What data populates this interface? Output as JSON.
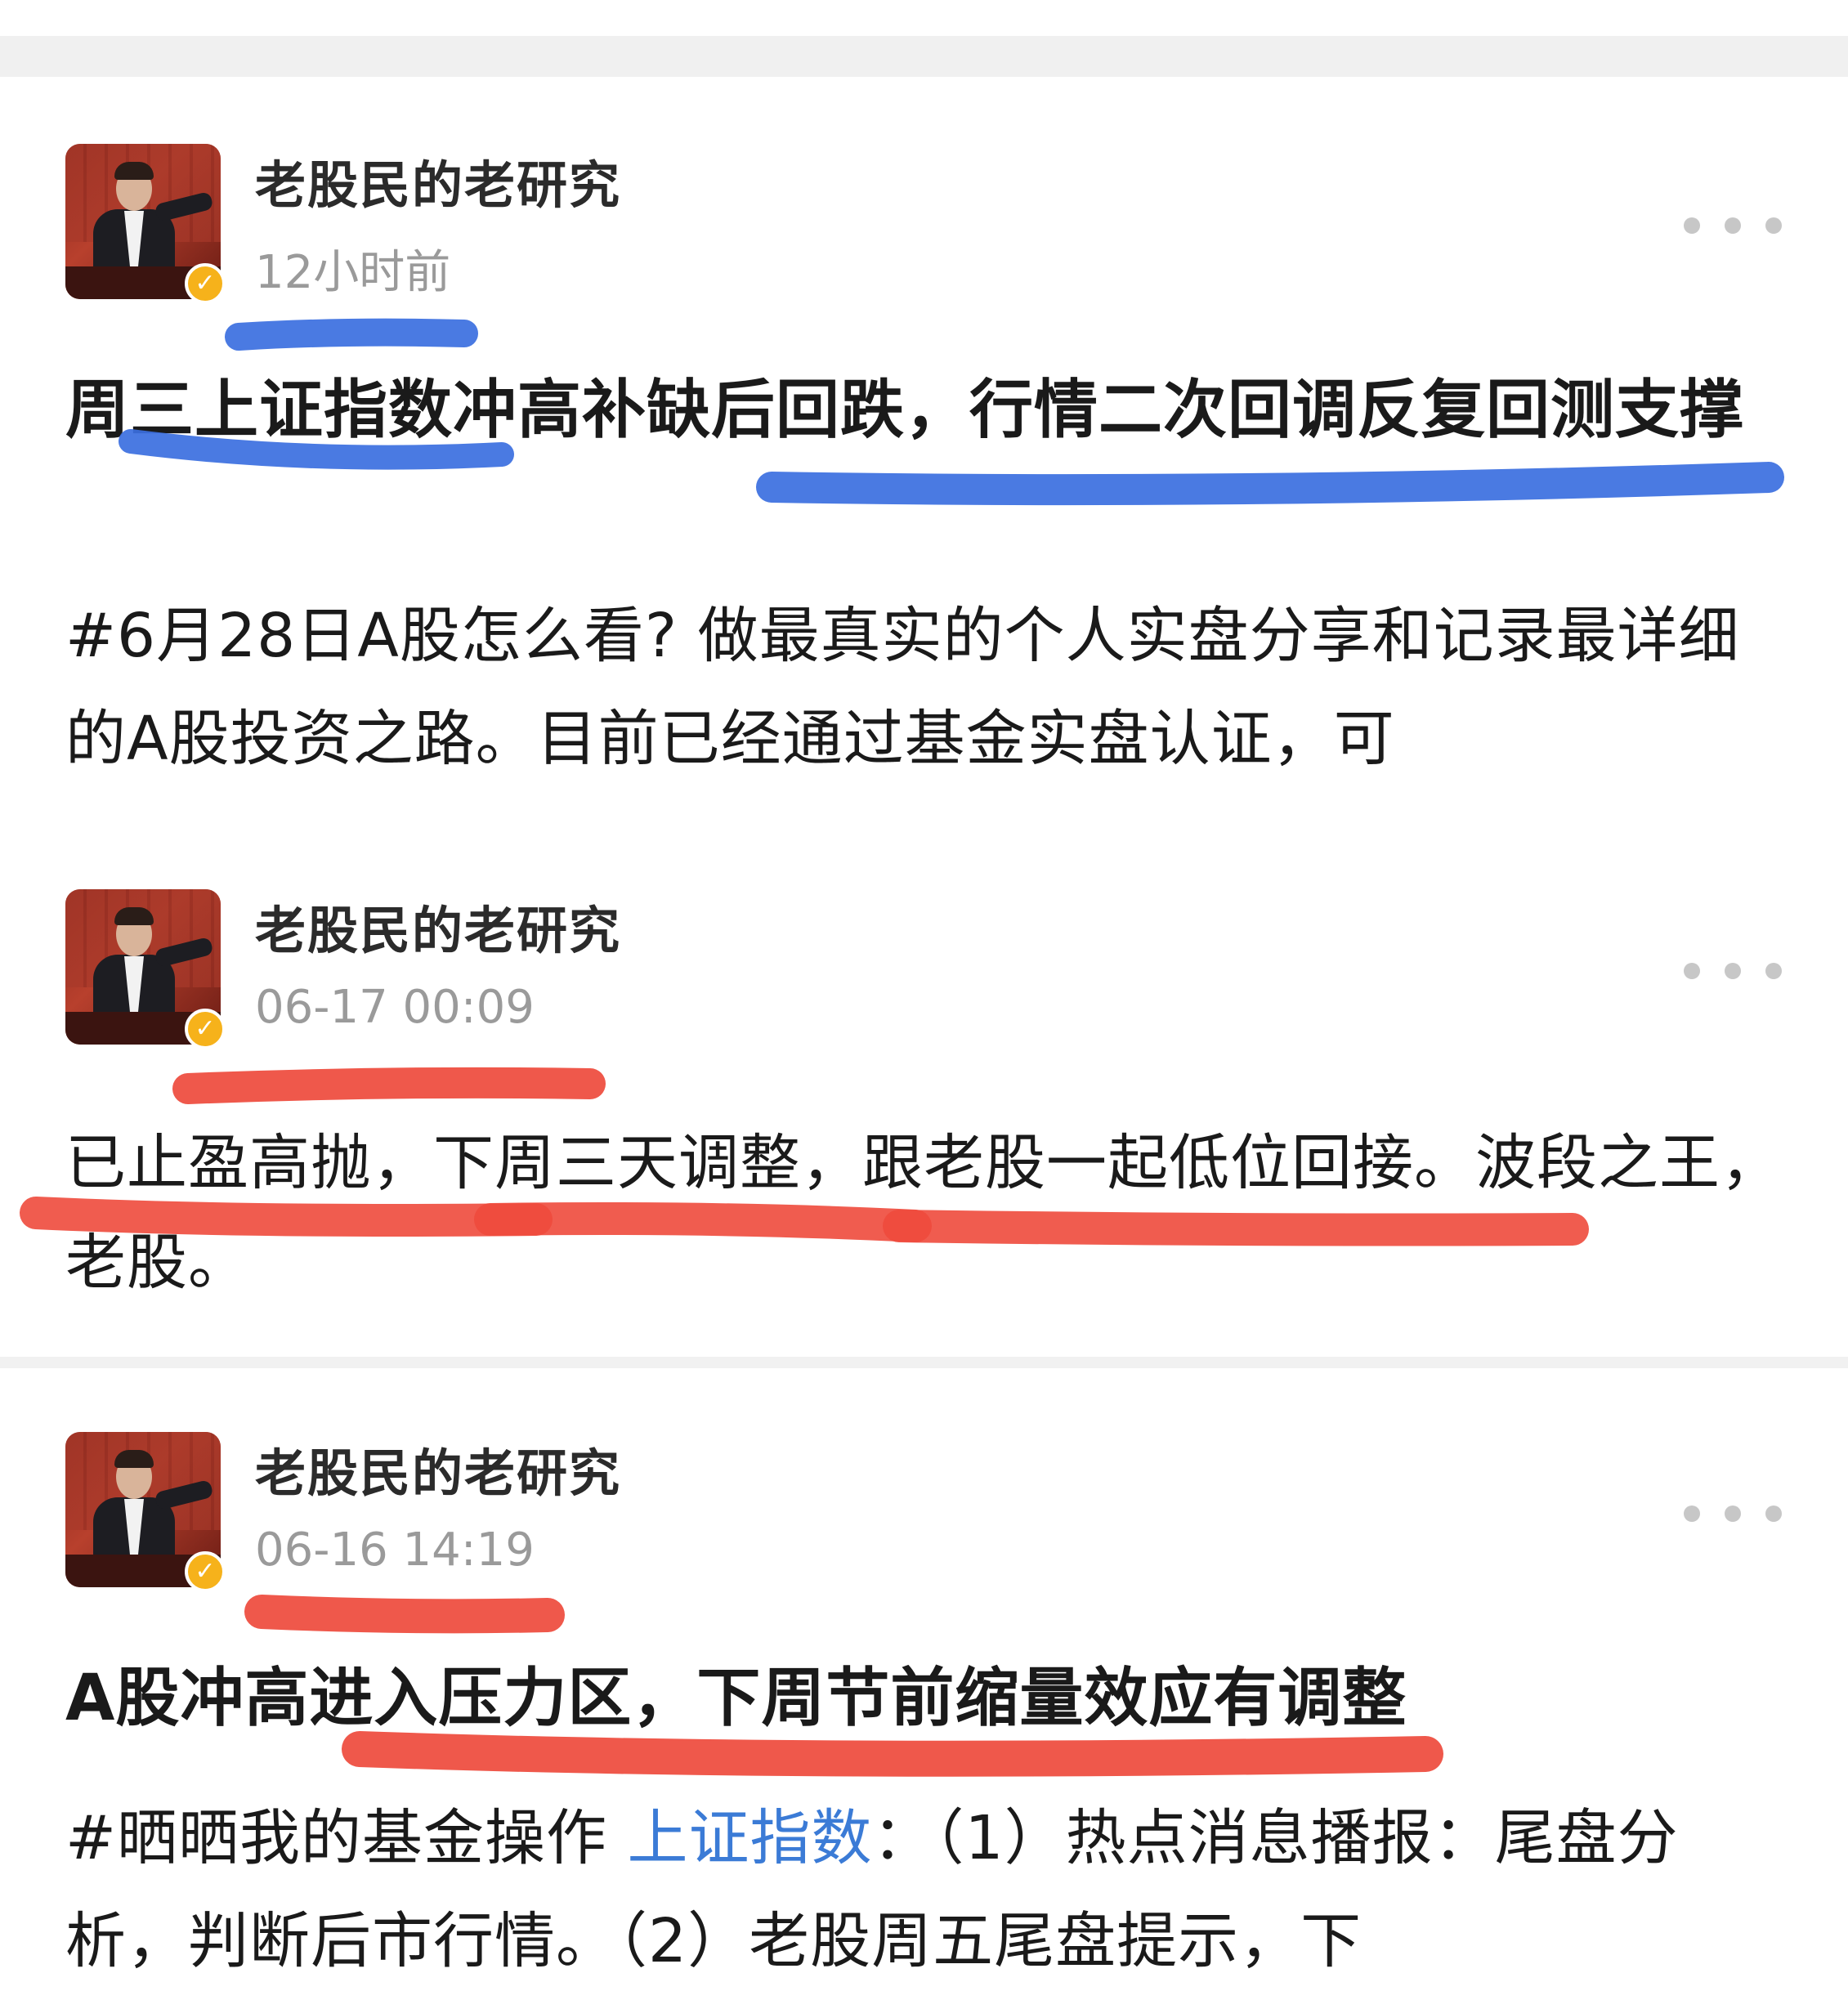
{
  "posts": [
    {
      "author": "老股民的老研究",
      "time": "12小时前",
      "title": "周三上证指数冲高补缺后回跌，行情二次回调反复回测支撑",
      "body": "#6月28日A股怎么看? 做最真实的个人实盘分享和记录最详细的A股投资之路。目前已经通过基金实盘认证，可"
    },
    {
      "author": "老股民的老研究",
      "time": "06-17 00:09",
      "body": "已止盈高抛，下周三天调整，跟老股一起低位回接。波段之王，老股。"
    },
    {
      "author": "老股民的老研究",
      "time": "06-16 14:19",
      "title": "A股冲高进入压力区，下周节前缩量效应有调整",
      "body_prefix": "#晒晒我的基金操作 ",
      "body_link": "上证指数",
      "body_suffix": "：（1）热点消息播报：尾盘分析，判断后市行情。（2）老股周五尾盘提示，下"
    }
  ],
  "annotations": {
    "blue_color": "#3b6fe0",
    "red_color": "#ee4a3c"
  },
  "icons": {
    "more": "more-dots-icon",
    "verified": "verified-badge-icon"
  }
}
